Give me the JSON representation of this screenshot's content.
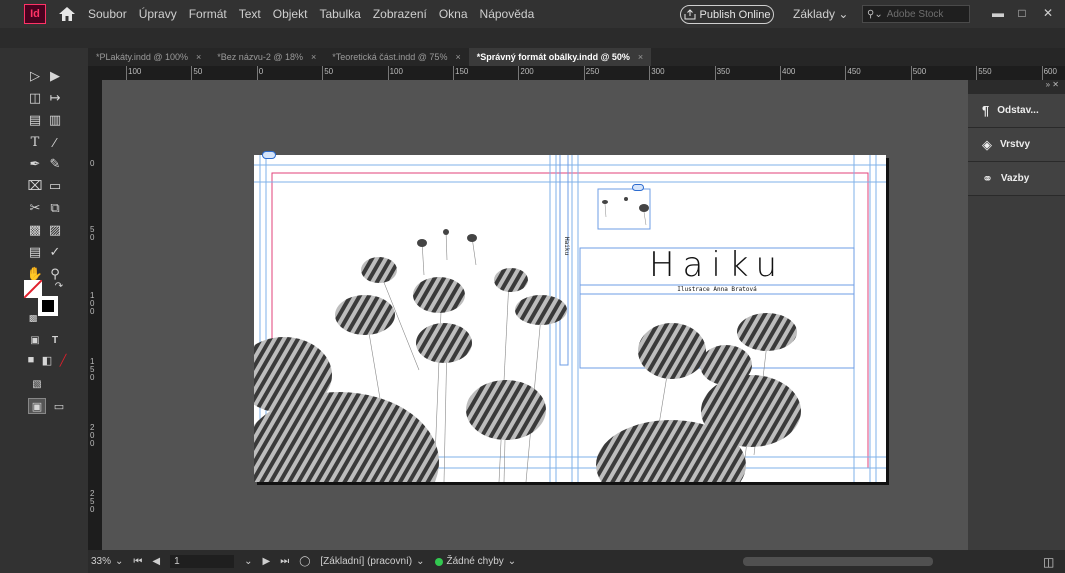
{
  "app": {
    "logo": "Id"
  },
  "menu": [
    "Soubor",
    "Úpravy",
    "Formát",
    "Text",
    "Objekt",
    "Tabulka",
    "Zobrazení",
    "Okna",
    "Nápověda"
  ],
  "publish_label": "Publish Online",
  "workspace_label": "Základy",
  "stock_placeholder": "Adobe Stock",
  "tabs": [
    {
      "label": "*PLakáty.indd @ 100%",
      "active": false
    },
    {
      "label": "*Bez názvu-2 @ 18%",
      "active": false
    },
    {
      "label": "*Teoretická část.indd @ 75%",
      "active": false
    },
    {
      "label": "*Správný formát obálky.indd @ 50%",
      "active": true
    }
  ],
  "ruler_h_labels": [
    "100",
    "50",
    "0",
    "50",
    "100",
    "150",
    "200",
    "250",
    "300",
    "350",
    "400",
    "450",
    "500",
    "550",
    "600"
  ],
  "ruler_v_labels": [
    "0",
    "50",
    "100",
    "150",
    "200",
    "250"
  ],
  "document": {
    "title": "Haiku",
    "subtitle": "Ilustrace Anna Bratová",
    "spine_text": "Haiku"
  },
  "right_panel": {
    "items": [
      {
        "label": "Odstav...",
        "icon": "paragraph-icon"
      },
      {
        "label": "Vrstvy",
        "icon": "layers-icon"
      },
      {
        "label": "Vazby",
        "icon": "links-icon"
      }
    ]
  },
  "status": {
    "zoom": "33%",
    "page": "1",
    "style": "[Základní] (pracovní)",
    "preflight": "Žádné chyby"
  },
  "colors": {
    "accent": "#ff3366",
    "margin_guide": "#e0407a",
    "column_guide": "#7fb2e8",
    "status_ok": "#32c850"
  }
}
